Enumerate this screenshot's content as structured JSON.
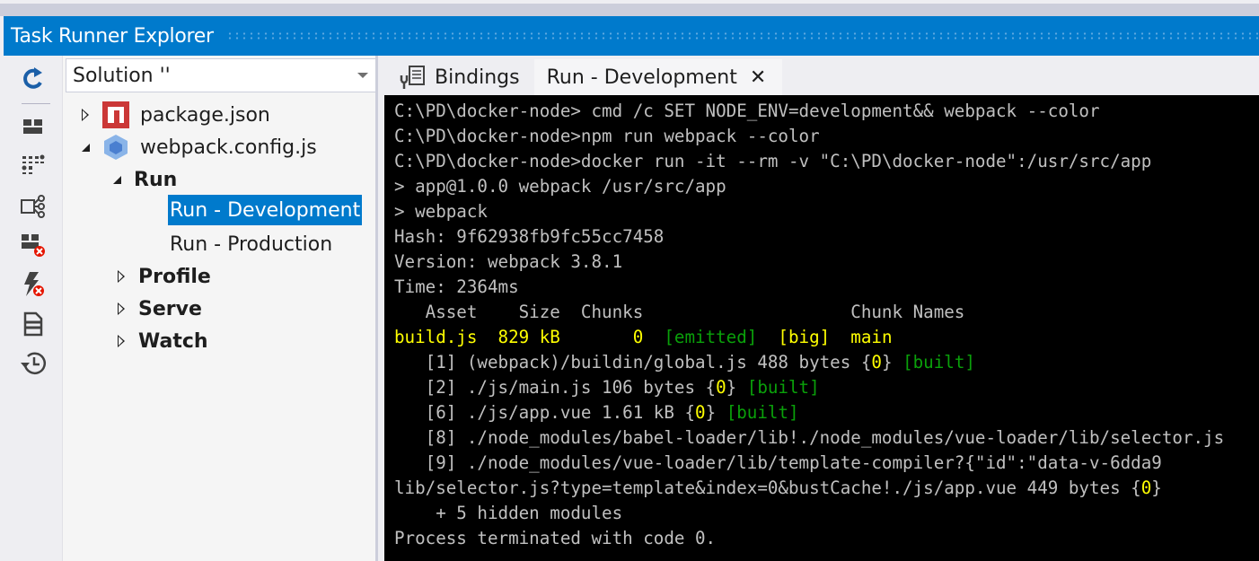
{
  "window": {
    "title": "Task Runner Explorer"
  },
  "toolbar": {
    "buttons": [
      {
        "name": "refresh",
        "icon": "refresh-icon"
      },
      {
        "name": "group-tasks",
        "icon": "group-icon"
      },
      {
        "name": "list-view",
        "icon": "list-view-icon"
      },
      {
        "name": "bindings-tree",
        "icon": "bindings-icon"
      },
      {
        "name": "clear-bindings",
        "icon": "clear-bindings-icon"
      },
      {
        "name": "clear-task-output",
        "icon": "lightning-error-icon"
      },
      {
        "name": "output",
        "icon": "document-icon"
      },
      {
        "name": "history",
        "icon": "history-icon"
      }
    ]
  },
  "solution_selector": {
    "value": "Solution ''"
  },
  "tree": {
    "items": [
      {
        "label": "package.json",
        "icon": "npm-icon",
        "state": "collapsed"
      },
      {
        "label": "webpack.config.js",
        "icon": "webpack-icon",
        "state": "expanded"
      },
      {
        "label": "Run",
        "state": "expanded",
        "bold": true
      },
      {
        "label": "Run - Development",
        "selected": true
      },
      {
        "label": "Run - Production"
      },
      {
        "label": "Profile",
        "state": "collapsed",
        "bold": true
      },
      {
        "label": "Serve",
        "state": "collapsed",
        "bold": true
      },
      {
        "label": "Watch",
        "state": "collapsed",
        "bold": true
      }
    ]
  },
  "tabs": [
    {
      "label": "Bindings",
      "icon": "bindings-tab-icon",
      "active": false
    },
    {
      "label": "Run - Development",
      "close": "✕",
      "active": true
    }
  ],
  "console": {
    "colors": {
      "default": "#c0c0c0",
      "yellow": "#ffff00",
      "green": "#0aa00a",
      "background": "#000000"
    },
    "lines": [
      [
        {
          "t": "C:\\PD\\docker-node> cmd /c SET NODE_ENV=development&& webpack --color",
          "c": "gray"
        }
      ],
      [
        {
          "t": "C:\\PD\\docker-node>npm run webpack --color",
          "c": "gray"
        }
      ],
      [
        {
          "t": "C:\\PD\\docker-node>docker run -it --rm -v \"C:\\PD\\docker-node\":/usr/src/app",
          "c": "gray"
        }
      ],
      [
        {
          "t": "> app@1.0.0 webpack /usr/src/app",
          "c": "gray"
        }
      ],
      [
        {
          "t": "> webpack",
          "c": "gray"
        }
      ],
      [
        {
          "t": "Hash: 9f62938fb9fc55cc7458",
          "c": "gray"
        }
      ],
      [
        {
          "t": "Version: webpack 3.8.1",
          "c": "gray"
        }
      ],
      [
        {
          "t": "Time: 2364ms",
          "c": "gray"
        }
      ],
      [
        {
          "t": "   Asset    Size  Chunks                    Chunk Names",
          "c": "gray"
        }
      ],
      [
        {
          "t": "build.js  829 kB       0  ",
          "c": "yellow"
        },
        {
          "t": "[emitted]",
          "c": "green"
        },
        {
          "t": "  [big]  main",
          "c": "yellow"
        }
      ],
      [
        {
          "t": "   [1] (webpack)/buildin/global.js 488 bytes {",
          "c": "gray"
        },
        {
          "t": "0",
          "c": "yellow"
        },
        {
          "t": "} ",
          "c": "gray"
        },
        {
          "t": "[built]",
          "c": "green"
        }
      ],
      [
        {
          "t": "   [2] ./js/main.js 106 bytes {",
          "c": "gray"
        },
        {
          "t": "0",
          "c": "yellow"
        },
        {
          "t": "} ",
          "c": "gray"
        },
        {
          "t": "[built]",
          "c": "green"
        }
      ],
      [
        {
          "t": "   [6] ./js/app.vue 1.61 kB {",
          "c": "gray"
        },
        {
          "t": "0",
          "c": "yellow"
        },
        {
          "t": "} ",
          "c": "gray"
        },
        {
          "t": "[built]",
          "c": "green"
        }
      ],
      [
        {
          "t": "   [8] ./node_modules/babel-loader/lib!./node_modules/vue-loader/lib/selector.js",
          "c": "gray"
        }
      ],
      [
        {
          "t": "   [9] ./node_modules/vue-loader/lib/template-compiler?{\"id\":\"data-v-6dda9",
          "c": "gray"
        }
      ],
      [
        {
          "t": "lib/selector.js?type=template&index=0&bustCache!./js/app.vue 449 bytes {",
          "c": "gray"
        },
        {
          "t": "0",
          "c": "yellow"
        },
        {
          "t": "}",
          "c": "gray"
        }
      ],
      [
        {
          "t": "    + 5 hidden modules",
          "c": "gray"
        }
      ],
      [
        {
          "t": "Process terminated with code 0.",
          "c": "gray"
        }
      ]
    ]
  }
}
